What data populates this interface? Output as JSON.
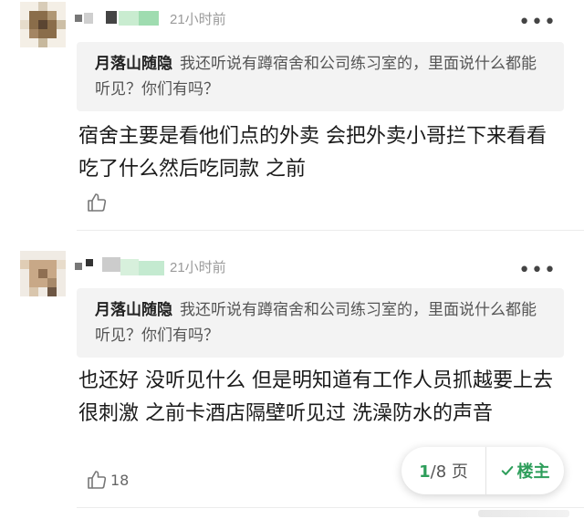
{
  "comments": [
    {
      "time": "21小时前",
      "more_icon": "more-horizontal-icon",
      "quote_author": "月落山随隐",
      "quote_text": "我还听说有蹲宿舍和公司练习室的，里面说什么都能听见？你们有吗？",
      "body": "宿舍主要是看他们点的外卖 会把外卖小哥拦下来看看吃了什么然后吃同款 之前",
      "like_icon": "thumbs-up-icon",
      "like_count": ""
    },
    {
      "time": "21小时前",
      "more_icon": "more-horizontal-icon",
      "quote_author": "月落山随隐",
      "quote_text": "我还听说有蹲宿舍和公司练习室的，里面说什么都能听见？你们有吗？",
      "body": "也还好 没听见什么 但是明知道有工作人员抓越要上去 很刺激 之前卡酒店隔壁听见过    洗澡防水的声音",
      "like_icon": "thumbs-up-icon",
      "like_count": "18"
    }
  ],
  "pager": {
    "current": "1",
    "total": "/8 页",
    "op_label": "楼主",
    "check_icon": "check-icon"
  },
  "colors": {
    "accent": "#2e9e5b",
    "quote_bg": "#f3f3f3"
  }
}
